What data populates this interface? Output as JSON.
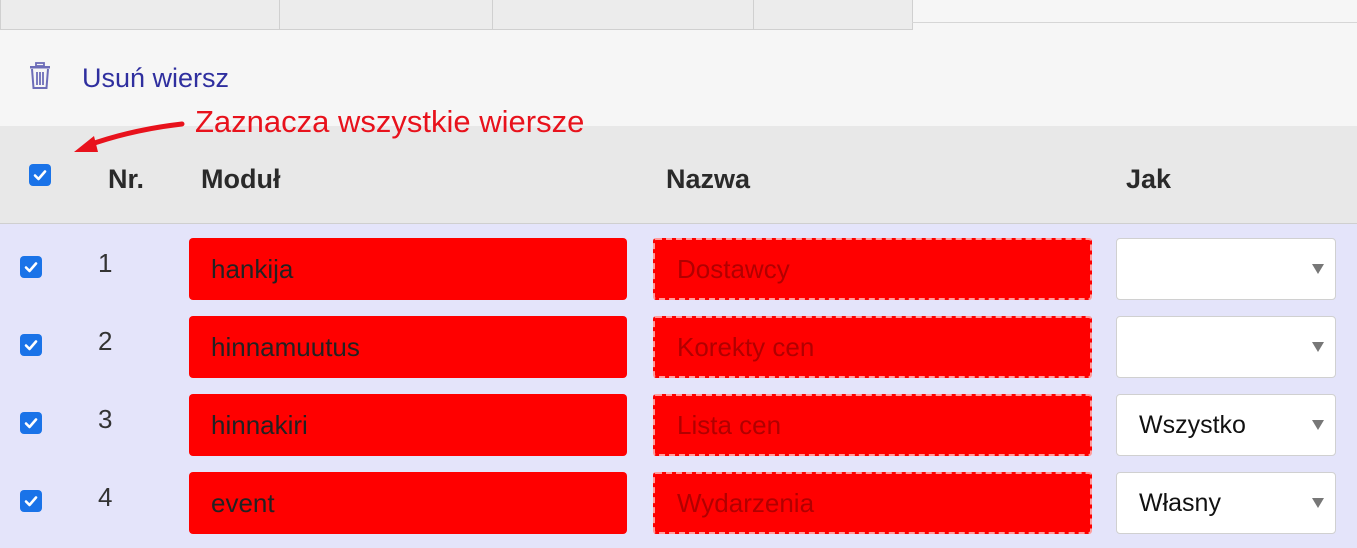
{
  "toolbar": {
    "delete_row_label": "Usuń wiersz",
    "delete_icon": "trash-icon"
  },
  "annotation": {
    "text": "Zaznacza wszystkie wiersze",
    "color": "#e8121c"
  },
  "table": {
    "select_all_checked": true,
    "headers": {
      "nr": "Nr.",
      "module": "Moduł",
      "name": "Nazwa",
      "how": "Jak"
    },
    "rows": [
      {
        "checked": true,
        "nr": "1",
        "module": "hankija",
        "name": "Dostawcy",
        "how": ""
      },
      {
        "checked": true,
        "nr": "2",
        "module": "hinnamuutus",
        "name": "Korekty cen",
        "how": ""
      },
      {
        "checked": true,
        "nr": "3",
        "module": "hinnakiri",
        "name": "Lista cen",
        "how": "Wszystko"
      },
      {
        "checked": true,
        "nr": "4",
        "module": "event",
        "name": "Wydarzenia",
        "how": "Własny"
      }
    ]
  },
  "colors": {
    "checkbox": "#1a73e8",
    "cell_highlight": "#ff0000",
    "body_background": "#e4e4fa",
    "header_background": "#e8e8e8"
  }
}
